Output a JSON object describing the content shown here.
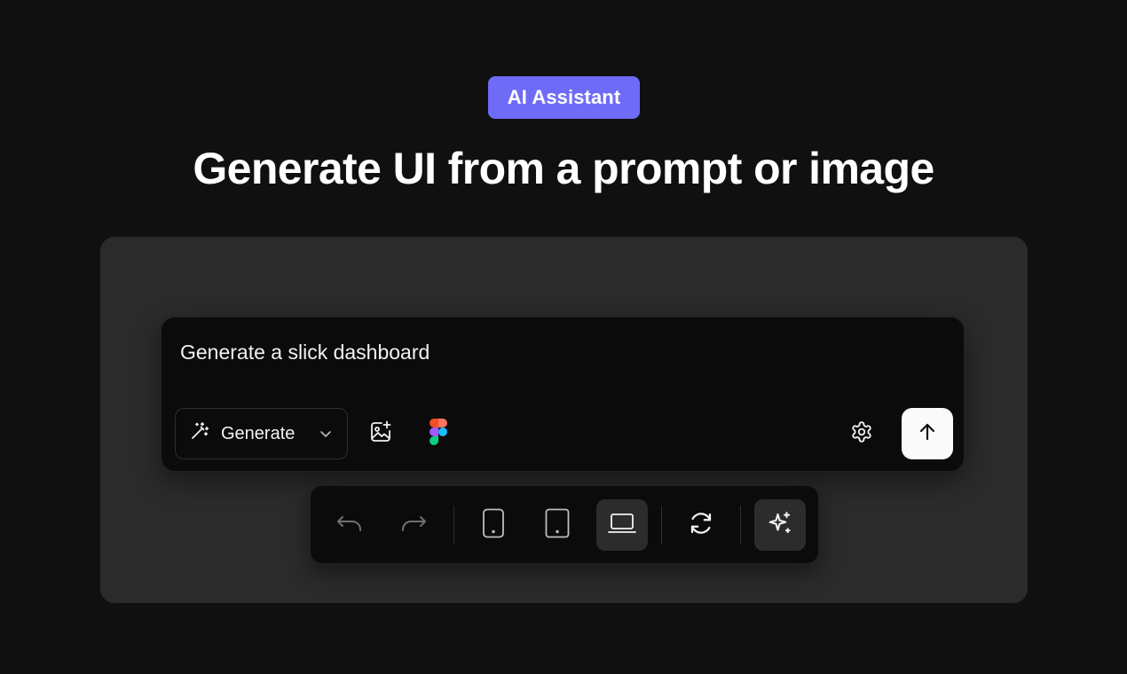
{
  "badge": {
    "label": "AI Assistant",
    "color": "#6e6cf6"
  },
  "headline": "Generate UI from a prompt or image",
  "composer": {
    "prompt_value": "Generate a slick dashboard",
    "mode": {
      "selected": "Generate",
      "icon": "magic-wand-icon"
    },
    "tools": [
      {
        "name": "add-image",
        "icon": "image-plus-icon"
      },
      {
        "name": "figma-import",
        "icon": "figma-icon"
      }
    ],
    "settings_icon": "gear-icon",
    "send_icon": "arrow-up-icon"
  },
  "toolbar": {
    "buttons": [
      {
        "name": "undo",
        "icon": "undo-icon",
        "enabled": false
      },
      {
        "name": "redo",
        "icon": "redo-icon",
        "enabled": false
      },
      {
        "name": "mobile-view",
        "icon": "phone-icon",
        "active": false
      },
      {
        "name": "tablet-view",
        "icon": "tablet-icon",
        "active": false
      },
      {
        "name": "desktop-view",
        "icon": "laptop-icon",
        "active": true
      },
      {
        "name": "refresh",
        "icon": "refresh-icon",
        "active": false
      },
      {
        "name": "ai-enhance",
        "icon": "sparkles-icon",
        "active": true
      }
    ]
  }
}
